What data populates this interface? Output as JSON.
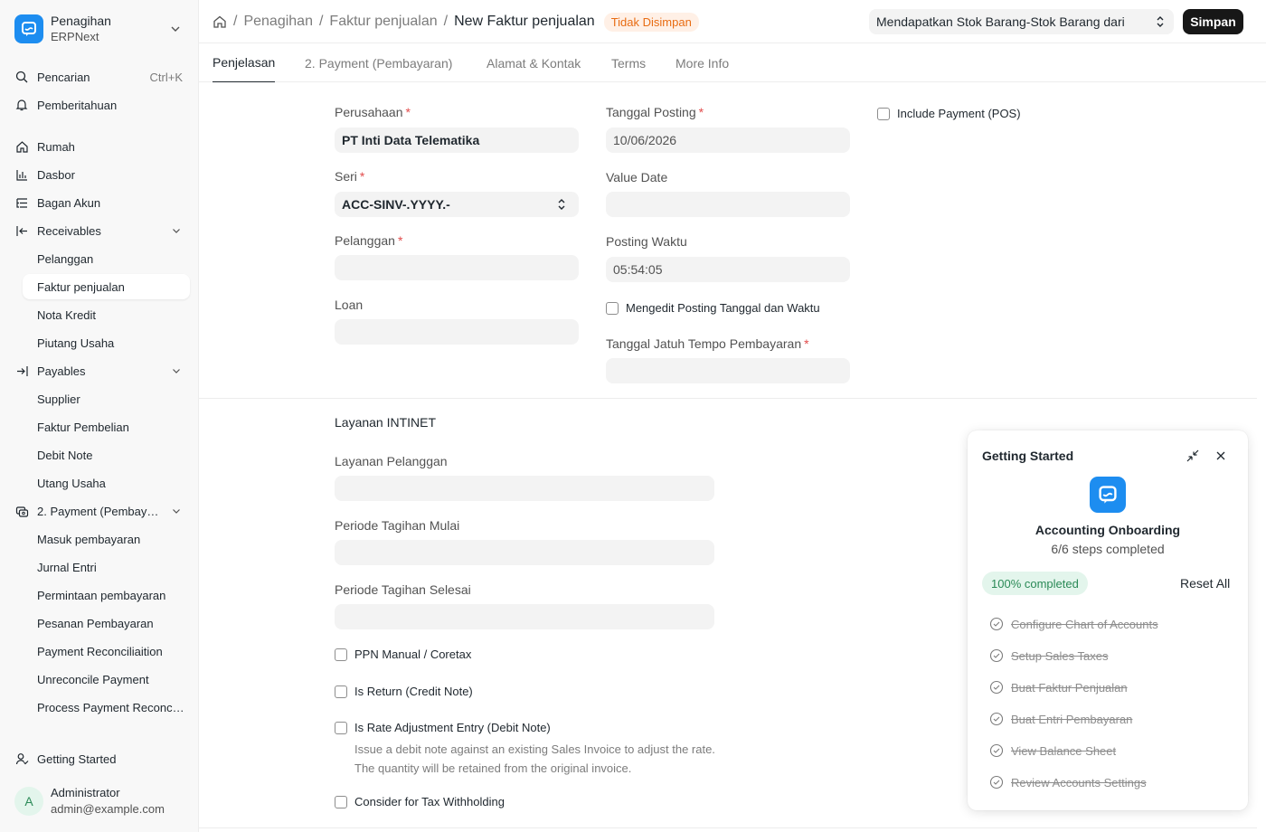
{
  "app": {
    "name": "Penagihan",
    "subtitle": "ERPNext"
  },
  "sidebar": {
    "search_label": "Pencarian",
    "search_shortcut": "Ctrl+K",
    "notifications_label": "Pemberitahuan",
    "items": [
      {
        "label": "Rumah"
      },
      {
        "label": "Dasbor"
      },
      {
        "label": "Bagan Akun"
      },
      {
        "label": "Receivables"
      },
      {
        "label": "Pelanggan"
      },
      {
        "label": "Faktur penjualan"
      },
      {
        "label": "Nota Kredit"
      },
      {
        "label": "Piutang Usaha"
      },
      {
        "label": "Payables"
      },
      {
        "label": "Supplier"
      },
      {
        "label": "Faktur Pembelian"
      },
      {
        "label": "Debit Note"
      },
      {
        "label": "Utang Usaha"
      },
      {
        "label": "2. Payment (Pembay…"
      },
      {
        "label": "Masuk pembayaran"
      },
      {
        "label": "Jurnal Entri"
      },
      {
        "label": "Permintaan pembayaran"
      },
      {
        "label": "Pesanan Pembayaran"
      },
      {
        "label": "Payment Reconciliaition"
      },
      {
        "label": "Unreconcile Payment"
      },
      {
        "label": "Process Payment Reconc…"
      }
    ],
    "getting_started_label": "Getting Started",
    "user": {
      "initial": "A",
      "name": "Administrator",
      "email": "admin@example.com"
    }
  },
  "header": {
    "breadcrumbs": [
      "Penagihan",
      "Faktur penjualan"
    ],
    "title": "New Faktur penjualan",
    "status_badge": "Tidak Disimpan",
    "get_items_select": "Mendapatkan Stok Barang-Stok Barang dari",
    "save_label": "Simpan"
  },
  "tabs": [
    "Penjelasan",
    "2. Payment (Pembayaran)",
    "Alamat & Kontak",
    "Terms",
    "More Info"
  ],
  "form": {
    "company_label": "Perusahaan",
    "company_value": "PT Inti Data Telematika",
    "series_label": "Seri",
    "series_value": "ACC-SINV-.YYYY.-",
    "customer_label": "Pelanggan",
    "customer_value": "",
    "loan_label": "Loan",
    "loan_value": "",
    "posting_date_label": "Tanggal Posting",
    "posting_date_value": "10/06/2026",
    "value_date_label": "Value Date",
    "value_date_value": "",
    "posting_time_label": "Posting Waktu",
    "posting_time_value": "05:54:05",
    "edit_posting_label": "Mengedit Posting Tanggal dan Waktu",
    "due_date_label": "Tanggal Jatuh Tempo Pembayaran",
    "due_date_value": "",
    "include_payment_label": "Include Payment (POS)",
    "section_title": "Layanan INTINET",
    "service_customer_label": "Layanan Pelanggan",
    "billing_start_label": "Periode Tagihan Mulai",
    "billing_end_label": "Periode Tagihan Selesai",
    "ppn_label": "PPN Manual / Coretax",
    "is_return_label": "Is Return (Credit Note)",
    "rate_adjust_label": "Is Rate Adjustment Entry (Debit Note)",
    "rate_adjust_desc": "Issue a debit note against an existing Sales Invoice to adjust the rate. The quantity will be retained from the original invoice.",
    "tax_withholding_label": "Consider for Tax Withholding"
  },
  "getting_started": {
    "title": "Getting Started",
    "module_name": "Accounting Onboarding",
    "steps_completed": "6/6 steps completed",
    "progress_label": "100% completed",
    "progress": 1.0,
    "reset_label": "Reset All",
    "steps": [
      "Configure Chart of Accounts",
      "Setup Sales Taxes",
      "Buat Faktur Penjualan",
      "Buat Entri Pembayaran",
      "View Balance Sheet",
      "Review Accounts Settings"
    ]
  },
  "colors": {
    "accent": "#1d8df0",
    "primary_button": "#171717",
    "unsaved_badge": "#e86c13",
    "success": "#2b8a57"
  }
}
